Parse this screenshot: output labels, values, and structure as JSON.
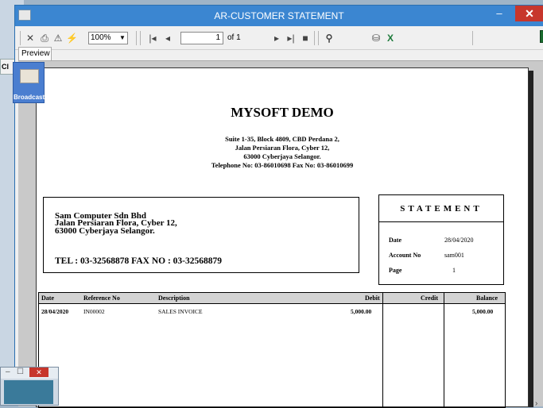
{
  "window": {
    "title": "AR-CUSTOMER STATEMENT"
  },
  "background": {
    "item_label": "Cl"
  },
  "toolbar": {
    "zoom_value": "100%",
    "page_current": "1",
    "page_of": "of 1"
  },
  "tabs": [
    {
      "label": "Preview"
    }
  ],
  "broadcast": {
    "label": "Broadcast"
  },
  "report": {
    "company": "MYSOFT DEMO",
    "address_lines": [
      "Suite 1-35, Block 4809, CBD Perdana 2,",
      "Jalan Persiaran Flora, Cyber 12,",
      "63000 Cyberjaya Selangor.",
      "Telephone No: 03-86010698    Fax No: 03-86010699"
    ],
    "customer": {
      "name": "Sam Computer Sdn Bhd",
      "address1": "Jalan Persiaran Flora, Cyber 12,",
      "address2": "63000 Cyberjaya Selangor.",
      "tel_fax": "TEL : 03-32568878    FAX NO : 03-32568879"
    },
    "statement": {
      "title": "STATEMENT",
      "date_label": "Date",
      "date_value": "28/04/2020",
      "account_label": "Account No",
      "account_value": "sam001",
      "page_label": "Page",
      "page_value": "1"
    },
    "table": {
      "headers": [
        "Date",
        "Reference No",
        "Description",
        "Debit",
        "Credit",
        "Balance"
      ],
      "rows": [
        [
          "28/04/2020",
          "IN00002",
          "SALES INVOICE",
          "5,000.00",
          "",
          "5,000.00"
        ]
      ]
    }
  }
}
